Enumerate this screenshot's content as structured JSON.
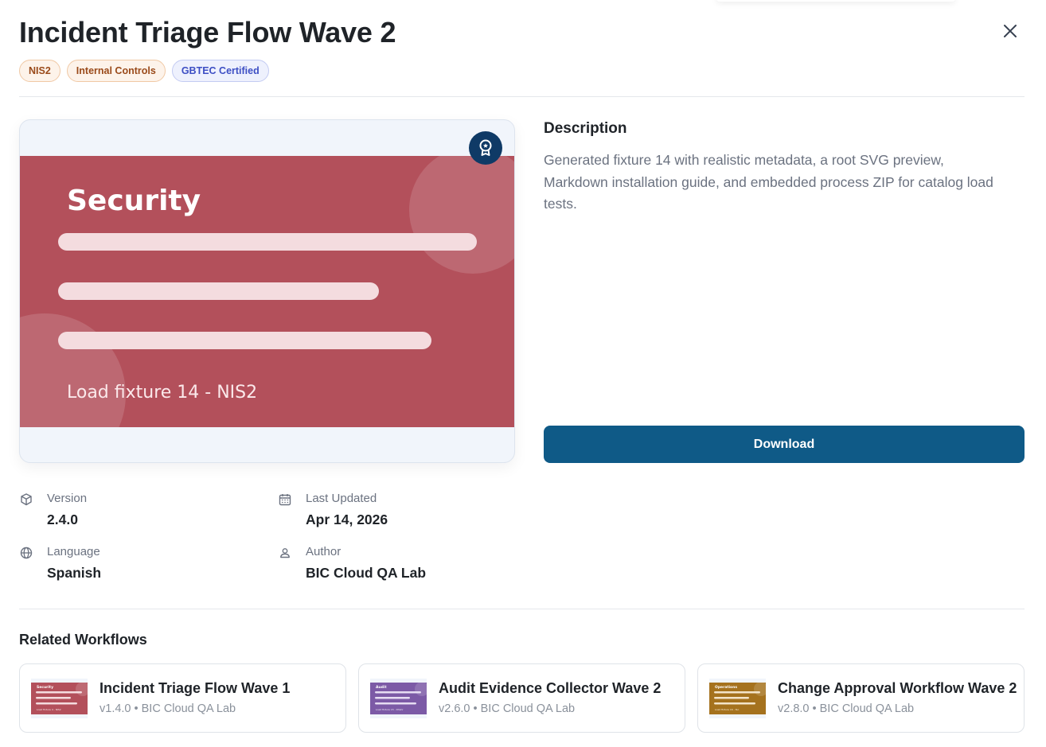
{
  "header": {
    "title": "Incident Triage Flow Wave 2",
    "close_icon": "close-icon"
  },
  "tags": [
    {
      "label": "NIS2",
      "style": "orange"
    },
    {
      "label": "Internal Controls",
      "style": "orange"
    },
    {
      "label": "GBTEC Certified",
      "style": "blue"
    }
  ],
  "preview": {
    "heading": "Security",
    "caption": "Load fixture 14 - NIS2",
    "banner_color": "#b3505b",
    "badge_icon": "award-icon"
  },
  "description": {
    "title": "Description",
    "text": "Generated fixture 14 with realistic metadata, a root SVG preview, Markdown installation guide, and embedded process ZIP for catalog load tests."
  },
  "download": {
    "label": "Download",
    "color": "#0f5a87"
  },
  "metadata": {
    "version": {
      "label": "Version",
      "value": "2.4.0",
      "icon": "package-icon"
    },
    "last_updated": {
      "label": "Last Updated",
      "value": "Apr 14, 2026",
      "icon": "calendar-icon"
    },
    "language": {
      "label": "Language",
      "value": "Spanish",
      "icon": "globe-icon"
    },
    "author": {
      "label": "Author",
      "value": "BIC Cloud QA Lab",
      "icon": "user-icon"
    }
  },
  "related": {
    "title": "Related Workflows",
    "items": [
      {
        "name": "Incident Triage Flow Wave 1",
        "meta": "v1.4.0 • BIC Cloud QA Lab",
        "thumb_label": "Security",
        "thumb_caption": "Load fixture 4 - NIS2",
        "color": "#b3505b"
      },
      {
        "name": "Audit Evidence Collector Wave 2",
        "meta": "v2.6.0 • BIC Cloud QA Lab",
        "thumb_label": "Audit",
        "thumb_caption": "Load fixture 15 - DSGV",
        "color": "#7c5aa6"
      },
      {
        "name": "Change Approval Workflow Wave 2",
        "meta": "v2.8.0 • BIC Cloud QA Lab",
        "thumb_label": "Operations",
        "thumb_caption": "Load fixture 16 - ISo",
        "color": "#a5721e"
      }
    ]
  }
}
